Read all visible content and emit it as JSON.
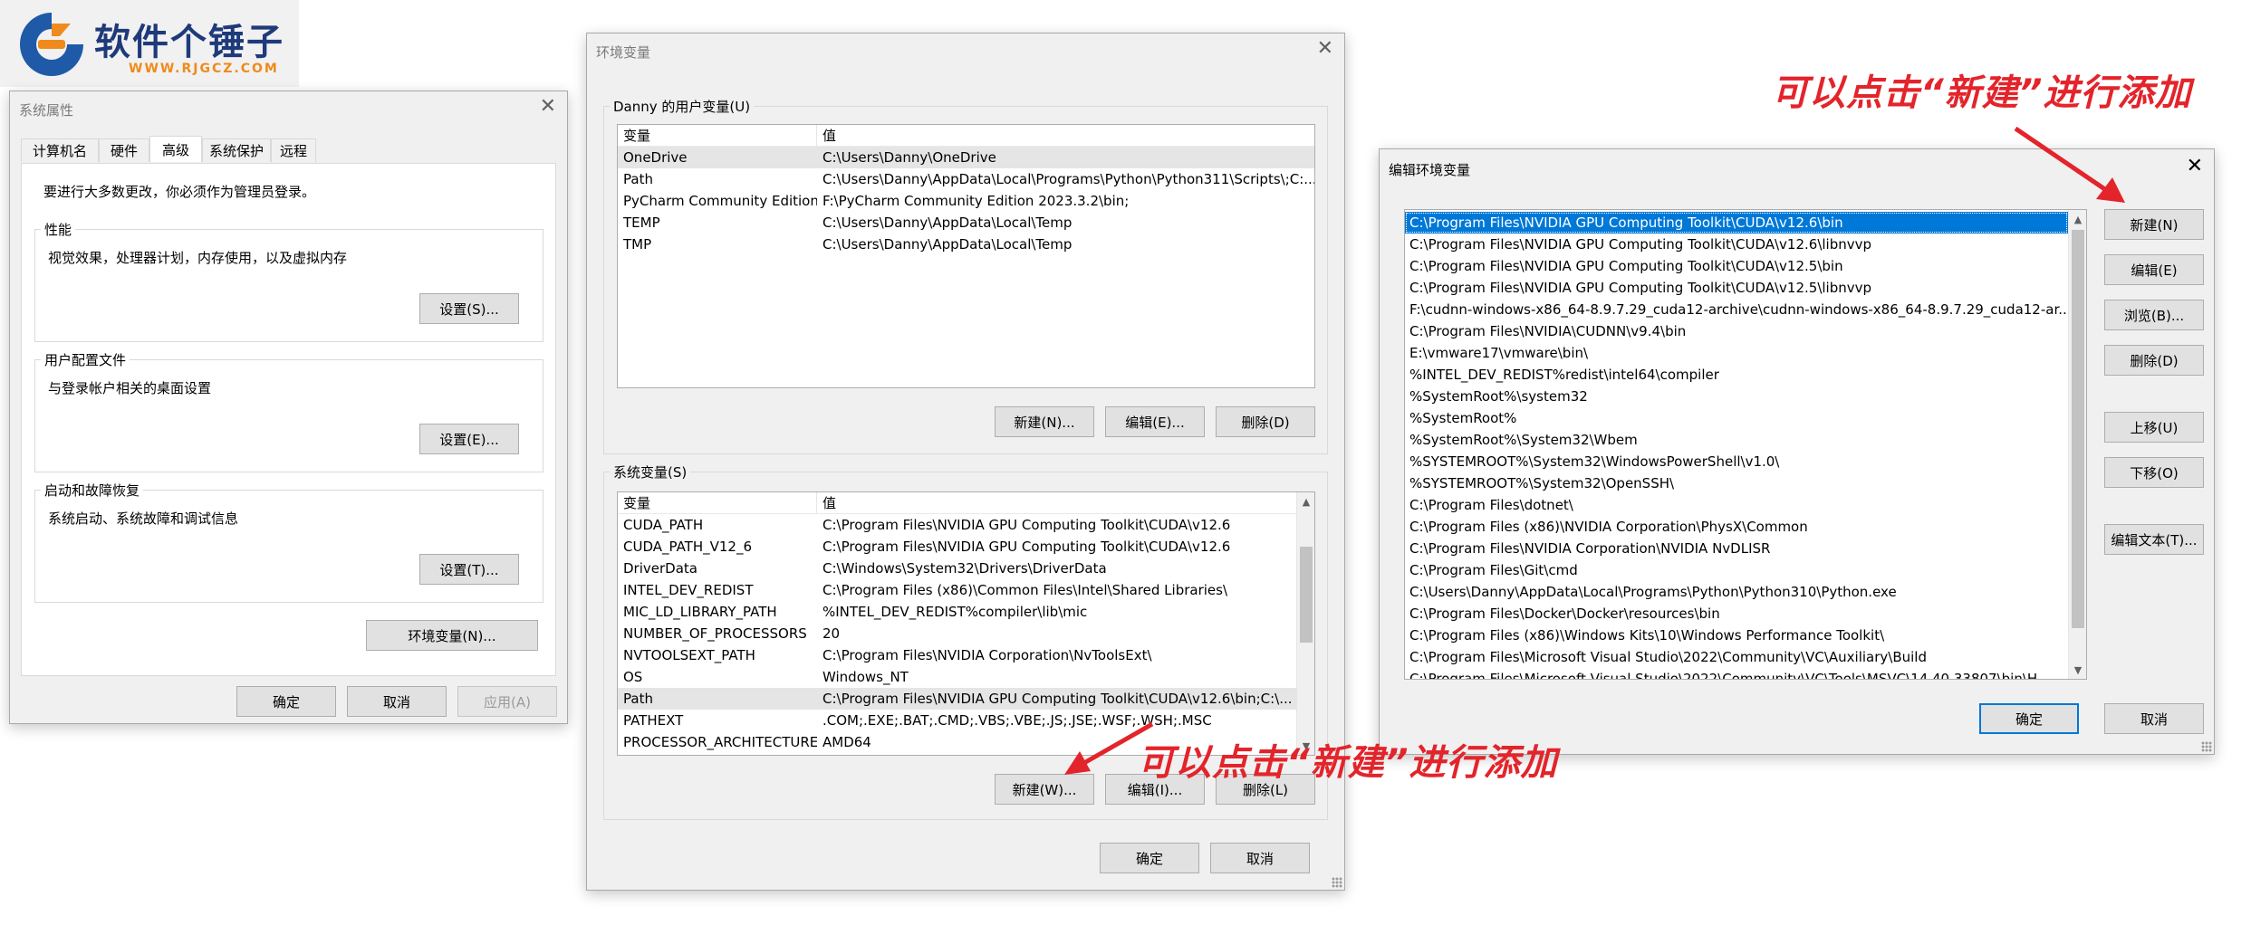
{
  "logo": {
    "text": "软件个锤子",
    "url": "WWW.RJGCZ.COM"
  },
  "sys_props": {
    "title": "系统属性",
    "tabs": [
      "计算机名",
      "硬件",
      "高级",
      "系统保护",
      "远程"
    ],
    "note": "要进行大多数更改，你必须作为管理员登录。",
    "perf": {
      "label": "性能",
      "desc": "视觉效果，处理器计划，内存使用，以及虚拟内存",
      "button": "设置(S)..."
    },
    "profile": {
      "label": "用户配置文件",
      "desc": "与登录帐户相关的桌面设置",
      "button": "设置(E)..."
    },
    "startup": {
      "label": "启动和故障恢复",
      "desc": "系统启动、系统故障和调试信息",
      "button": "设置(T)..."
    },
    "env_button": "环境变量(N)...",
    "ok": "确定",
    "cancel": "取消",
    "apply": "应用(A)"
  },
  "env_vars": {
    "title": "环境变量",
    "user_group": "Danny 的用户变量(U)",
    "col_var": "变量",
    "col_val": "值",
    "user_rows": [
      {
        "name": "OneDrive",
        "value": "C:\\Users\\Danny\\OneDrive"
      },
      {
        "name": "Path",
        "value": "C:\\Users\\Danny\\AppData\\Local\\Programs\\Python\\Python311\\Scripts\\;C:..."
      },
      {
        "name": "PyCharm Community Edition",
        "value": "F:\\PyCharm Community Edition 2023.3.2\\bin;"
      },
      {
        "name": "TEMP",
        "value": "C:\\Users\\Danny\\AppData\\Local\\Temp"
      },
      {
        "name": "TMP",
        "value": "C:\\Users\\Danny\\AppData\\Local\\Temp"
      }
    ],
    "user_new": "新建(N)...",
    "user_edit": "编辑(E)...",
    "user_delete": "删除(D)",
    "sys_group": "系统变量(S)",
    "sys_rows": [
      {
        "name": "CUDA_PATH",
        "value": "C:\\Program Files\\NVIDIA GPU Computing Toolkit\\CUDA\\v12.6"
      },
      {
        "name": "CUDA_PATH_V12_6",
        "value": "C:\\Program Files\\NVIDIA GPU Computing Toolkit\\CUDA\\v12.6"
      },
      {
        "name": "DriverData",
        "value": "C:\\Windows\\System32\\Drivers\\DriverData"
      },
      {
        "name": "INTEL_DEV_REDIST",
        "value": "C:\\Program Files (x86)\\Common Files\\Intel\\Shared Libraries\\"
      },
      {
        "name": "MIC_LD_LIBRARY_PATH",
        "value": "%INTEL_DEV_REDIST%compiler\\lib\\mic"
      },
      {
        "name": "NUMBER_OF_PROCESSORS",
        "value": "20"
      },
      {
        "name": "NVTOOLSEXT_PATH",
        "value": "C:\\Program Files\\NVIDIA Corporation\\NvToolsExt\\"
      },
      {
        "name": "OS",
        "value": "Windows_NT"
      },
      {
        "name": "Path",
        "value": "C:\\Program Files\\NVIDIA GPU Computing Toolkit\\CUDA\\v12.6\\bin;C:\\..."
      },
      {
        "name": "PATHEXT",
        "value": ".COM;.EXE;.BAT;.CMD;.VBS;.VBE;.JS;.JSE;.WSF;.WSH;.MSC"
      },
      {
        "name": "PROCESSOR_ARCHITECTURE",
        "value": "AMD64"
      }
    ],
    "sys_new": "新建(W)...",
    "sys_edit": "编辑(I)...",
    "sys_delete": "删除(L)",
    "ok": "确定",
    "cancel": "取消"
  },
  "edit_env": {
    "title": "编辑环境变量",
    "entries": [
      "C:\\Program Files\\NVIDIA GPU Computing Toolkit\\CUDA\\v12.6\\bin",
      "C:\\Program Files\\NVIDIA GPU Computing Toolkit\\CUDA\\v12.6\\libnvvp",
      "C:\\Program Files\\NVIDIA GPU Computing Toolkit\\CUDA\\v12.5\\bin",
      "C:\\Program Files\\NVIDIA GPU Computing Toolkit\\CUDA\\v12.5\\libnvvp",
      "F:\\cudnn-windows-x86_64-8.9.7.29_cuda12-archive\\cudnn-windows-x86_64-8.9.7.29_cuda12-ar...",
      "C:\\Program Files\\NVIDIA\\CUDNN\\v9.4\\bin",
      "E:\\vmware17\\vmware\\bin\\",
      "%INTEL_DEV_REDIST%redist\\intel64\\compiler",
      "%SystemRoot%\\system32",
      "%SystemRoot%",
      "%SystemRoot%\\System32\\Wbem",
      "%SYSTEMROOT%\\System32\\WindowsPowerShell\\v1.0\\",
      "%SYSTEMROOT%\\System32\\OpenSSH\\",
      "C:\\Program Files\\dotnet\\",
      "C:\\Program Files (x86)\\NVIDIA Corporation\\PhysX\\Common",
      "C:\\Program Files\\NVIDIA Corporation\\NVIDIA NvDLISR",
      "C:\\Program Files\\Git\\cmd",
      "C:\\Users\\Danny\\AppData\\Local\\Programs\\Python\\Python310\\Python.exe",
      "C:\\Program Files\\Docker\\Docker\\resources\\bin",
      "C:\\Program Files (x86)\\Windows Kits\\10\\Windows Performance Toolkit\\",
      "C:\\Program Files\\Microsoft Visual Studio\\2022\\Community\\VC\\Auxiliary\\Build",
      "C:\\Program Files\\Microsoft Visual Studio\\2022\\Community\\VC\\Tools\\MSVC\\14.40.33807\\bin\\H..."
    ],
    "new": "新建(N)",
    "edit": "编辑(E)",
    "browse": "浏览(B)...",
    "delete": "删除(D)",
    "up": "上移(U)",
    "down": "下移(O)",
    "edit_text": "编辑文本(T)...",
    "ok": "确定",
    "cancel": "取消"
  },
  "annotations": {
    "top": "可以点击“新建”进行添加",
    "bottom": "可以点击“新建”进行添加"
  },
  "colors": {
    "accent": "#0078d7",
    "annotation": "#e3242b",
    "logo_orange": "#f08a1c",
    "logo_blue": "#1e5aa8"
  }
}
